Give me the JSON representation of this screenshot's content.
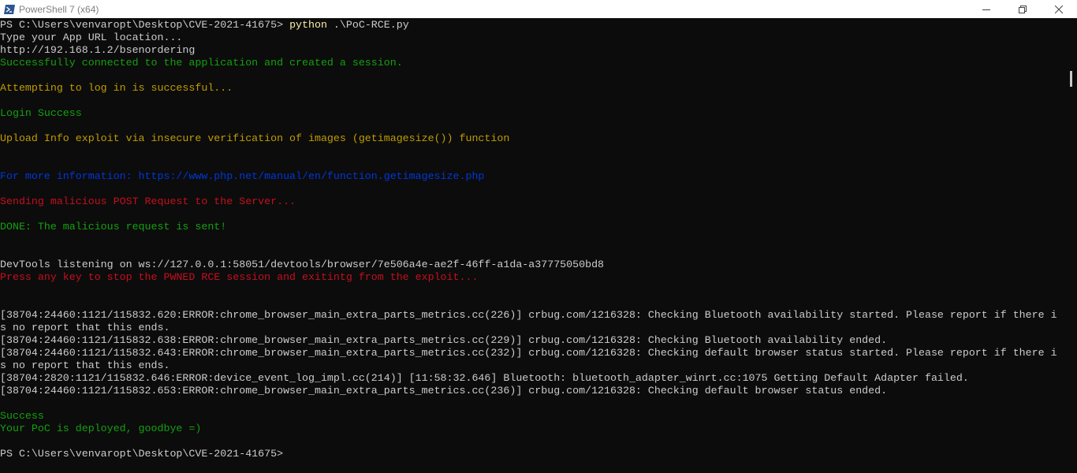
{
  "window": {
    "title": "PowerShell 7 (x64)"
  },
  "terminal": {
    "lines": [
      {
        "segments": [
          {
            "text": "PS C:\\Users\\venvaropt\\Desktop\\CVE-2021-41675> ",
            "color": "default"
          },
          {
            "text": "python",
            "color": "cmd"
          },
          {
            "text": " .\\PoC-RCE.py",
            "color": "default"
          }
        ]
      },
      {
        "segments": [
          {
            "text": "Type your App URL location...",
            "color": "default"
          }
        ]
      },
      {
        "segments": [
          {
            "text": "http://192.168.1.2/bsenordering",
            "color": "default"
          }
        ]
      },
      {
        "segments": [
          {
            "text": "Successfully connected to the application and created a session.",
            "color": "green"
          }
        ]
      },
      {
        "segments": []
      },
      {
        "segments": [
          {
            "text": "Attempting to log in is successful...",
            "color": "yellow"
          }
        ]
      },
      {
        "segments": []
      },
      {
        "segments": [
          {
            "text": "Login Success",
            "color": "green"
          }
        ]
      },
      {
        "segments": []
      },
      {
        "segments": [
          {
            "text": "Upload Info exploit via insecure verification of images (getimagesize()) function",
            "color": "yellow"
          }
        ]
      },
      {
        "segments": []
      },
      {
        "segments": []
      },
      {
        "segments": [
          {
            "text": "For more information: https://www.php.net/manual/en/function.getimagesize.php",
            "color": "blue"
          }
        ]
      },
      {
        "segments": []
      },
      {
        "segments": [
          {
            "text": "Sending malicious POST Request to the Server...",
            "color": "red"
          }
        ]
      },
      {
        "segments": []
      },
      {
        "segments": [
          {
            "text": "DONE: The malicious request is sent!",
            "color": "green"
          }
        ]
      },
      {
        "segments": []
      },
      {
        "segments": []
      },
      {
        "segments": [
          {
            "text": "DevTools listening on ws://127.0.0.1:58051/devtools/browser/7e506a4e-ae2f-46ff-a1da-a37775050bd8",
            "color": "default"
          }
        ]
      },
      {
        "segments": [
          {
            "text": "Press any key to stop the PWNED RCE session and exitintg from the exploit...",
            "color": "red"
          }
        ]
      },
      {
        "segments": []
      },
      {
        "segments": []
      },
      {
        "segments": [
          {
            "text": "[38704:24460:1121/115832.620:ERROR:chrome_browser_main_extra_parts_metrics.cc(226)] crbug.com/1216328: Checking Bluetooth availability started. Please report if there i",
            "color": "default"
          }
        ]
      },
      {
        "segments": [
          {
            "text": "s no report that this ends.",
            "color": "default"
          }
        ]
      },
      {
        "segments": [
          {
            "text": "[38704:24460:1121/115832.638:ERROR:chrome_browser_main_extra_parts_metrics.cc(229)] crbug.com/1216328: Checking Bluetooth availability ended.",
            "color": "default"
          }
        ]
      },
      {
        "segments": [
          {
            "text": "[38704:24460:1121/115832.643:ERROR:chrome_browser_main_extra_parts_metrics.cc(232)] crbug.com/1216328: Checking default browser status started. Please report if there i",
            "color": "default"
          }
        ]
      },
      {
        "segments": [
          {
            "text": "s no report that this ends.",
            "color": "default"
          }
        ]
      },
      {
        "segments": [
          {
            "text": "[38704:2820:1121/115832.646:ERROR:device_event_log_impl.cc(214)] [11:58:32.646] Bluetooth: bluetooth_adapter_winrt.cc:1075 Getting Default Adapter failed.",
            "color": "default"
          }
        ]
      },
      {
        "segments": [
          {
            "text": "[38704:24460:1121/115832.653:ERROR:chrome_browser_main_extra_parts_metrics.cc(236)] crbug.com/1216328: Checking default browser status ended.",
            "color": "default"
          }
        ]
      },
      {
        "segments": []
      },
      {
        "segments": [
          {
            "text": "Success",
            "color": "green"
          }
        ]
      },
      {
        "segments": [
          {
            "text": "Your PoC is deployed, goodbye =)",
            "color": "green"
          }
        ]
      },
      {
        "segments": []
      },
      {
        "segments": [
          {
            "text": "PS C:\\Users\\venvaropt\\Desktop\\CVE-2021-41675> ",
            "color": "default"
          }
        ]
      }
    ]
  },
  "colors": {
    "background": "#0c0c0c",
    "default": "#cccccc",
    "cmd": "#f9f1a5",
    "green": "#13a10e",
    "yellow": "#c19c00",
    "blue": "#0037da",
    "red": "#c50f1f"
  },
  "icons": {
    "app": "powershell-icon",
    "minimize": "minimize-icon",
    "maximize": "restore-icon",
    "close": "close-icon"
  }
}
